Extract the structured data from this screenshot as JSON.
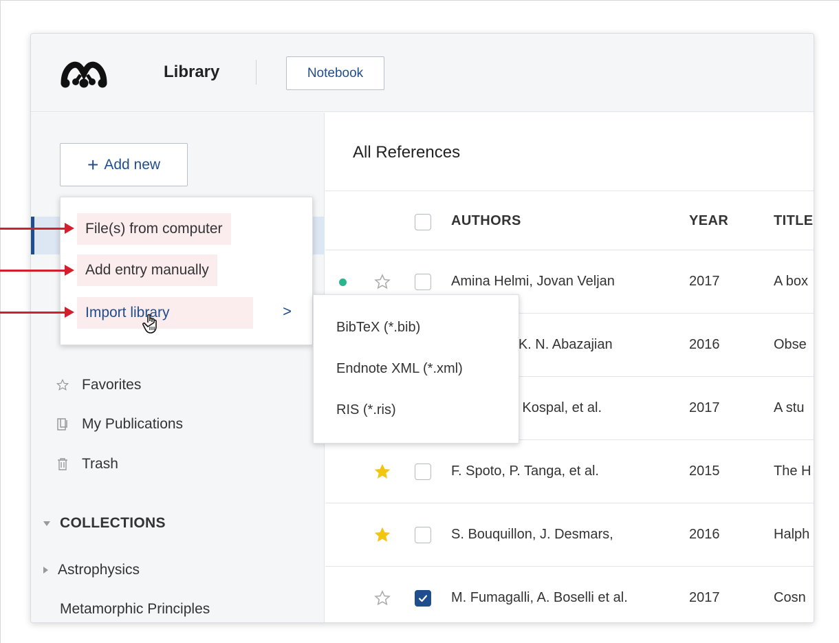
{
  "app": {
    "title": "Library",
    "notebook_label": "Notebook"
  },
  "sidebar": {
    "add_new_label": "Add new",
    "items": [
      {
        "label": "Favorites",
        "icon": "star-outline-icon"
      },
      {
        "label": "My Publications",
        "icon": "document-icon"
      },
      {
        "label": "Trash",
        "icon": "trash-icon"
      }
    ],
    "collections_header": "COLLECTIONS",
    "collections": [
      {
        "label": "Astrophysics",
        "expandable": true
      },
      {
        "label": "Metamorphic Principles",
        "expandable": false
      }
    ]
  },
  "add_menu": {
    "items": [
      {
        "label": "File(s) from computer"
      },
      {
        "label": "Add entry manually"
      },
      {
        "label": "Import library",
        "submenu_indicator": ">"
      }
    ]
  },
  "import_submenu": {
    "items": [
      "BibTeX (*.bib)",
      "Endnote XML (*.xml)",
      "RIS (*.ris)"
    ]
  },
  "main": {
    "heading": "All References",
    "columns": [
      "AUTHORS",
      "YEAR",
      "TITLE"
    ],
    "rows": [
      {
        "unread": true,
        "starred": false,
        "checked": false,
        "authors": "Amina Helmi, Jovan Veljan",
        "year": "2017",
        "title": "A box"
      },
      {
        "unread": false,
        "starred": false,
        "checked": false,
        "authors": "E. Santos, K. N. Abazajian",
        "year": "2016",
        "title": "Obse"
      },
      {
        "unread": false,
        "starred": false,
        "checked": false,
        "authors": "A. Moor, A. Kospal, et al.",
        "year": "2017",
        "title": "A stu"
      },
      {
        "unread": false,
        "starred": true,
        "checked": false,
        "authors": "F. Spoto, P. Tanga, et al.",
        "year": "2015",
        "title": "The H"
      },
      {
        "unread": false,
        "starred": true,
        "checked": false,
        "authors": "S. Bouquillon, J. Desmars,",
        "year": "2016",
        "title": "Halph"
      },
      {
        "unread": false,
        "starred": false,
        "checked": true,
        "authors": "M. Fumagalli, A. Boselli et al.",
        "year": "2017",
        "title": "Cosn"
      }
    ]
  },
  "colors": {
    "accent": "#1f4e8c",
    "annotation_arrow": "#d31f2b",
    "highlight": "#fbecee",
    "unread_dot": "#2bb58f",
    "star_filled": "#f2c511"
  }
}
